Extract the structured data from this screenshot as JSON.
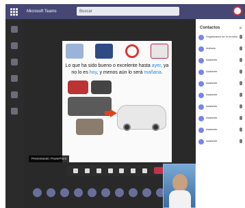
{
  "app": {
    "title": "Microsoft Teams"
  },
  "search": {
    "placeholder": "Buscar"
  },
  "stage": {
    "presenter_name": "Presentando: PowerPoint",
    "slide_text": {
      "part1": "Lo que ha sido bueno o excelente hasta ",
      "w_ayer": "ayer",
      "part2": ", ya no lo es ",
      "w_hoy": "hoy",
      "part3": ", y menos aún lo será ",
      "w_manana": "mañana",
      "part4": "."
    }
  },
  "toolbar": {
    "icons": [
      "camera-icon",
      "mic-icon",
      "share-icon",
      "more-icon",
      "hand-icon",
      "chat-icon",
      "participants-icon",
      "hangup-icon"
    ]
  },
  "attendee_count": 10,
  "panel": {
    "title": "Contactos",
    "contacts": [
      {
        "name": "Organizador de la reunión"
      },
      {
        "name": "Invitado"
      },
      {
        "name": "Asistente"
      },
      {
        "name": "Asistente"
      },
      {
        "name": "Asistente"
      },
      {
        "name": "Asistente"
      },
      {
        "name": "Asistente"
      },
      {
        "name": "Asistente"
      },
      {
        "name": "Asistente"
      },
      {
        "name": "Asistente"
      }
    ]
  },
  "colors": {
    "accent": "#464775",
    "hangup": "#c4314b",
    "highlight": "#1e88e5"
  }
}
